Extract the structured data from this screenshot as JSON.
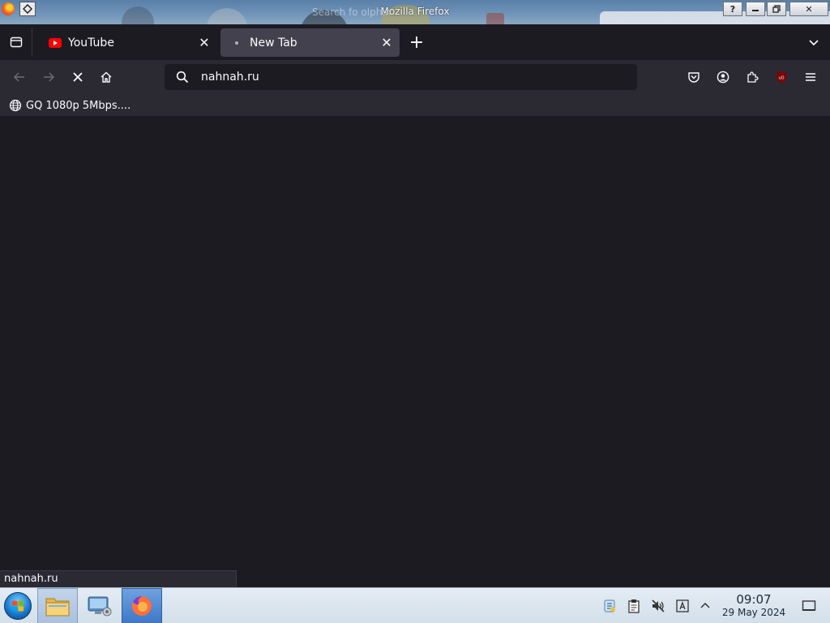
{
  "window": {
    "title": "Mozilla Firefox",
    "background_ghost_text": "Search fo          olphin",
    "help_glyph": "?",
    "close_glyph": "✕"
  },
  "tabs": [
    {
      "label": "YouTube",
      "favicon": "youtube-icon",
      "active": false,
      "close_glyph": "✕"
    },
    {
      "label": "New Tab",
      "favicon": "loading-dot-icon",
      "active": true,
      "close_glyph": "✕"
    }
  ],
  "new_tab_glyph": "+",
  "navbar": {
    "url": "nahnah.ru",
    "icons": [
      "back-icon",
      "forward-icon",
      "stop-icon",
      "home-icon",
      "search-icon",
      "pocket-icon",
      "account-icon",
      "extensions-icon",
      "ublock-icon",
      "menu-icon"
    ]
  },
  "bookmarks": [
    {
      "label": "GQ 1080p 5Mbps....",
      "favicon": "globe-icon"
    }
  ],
  "status_text": "nahnah.ru",
  "taskbar": {
    "items": [
      "file-manager-icon",
      "system-settings-icon",
      "firefox-icon"
    ],
    "tray": [
      "network-icon",
      "clipboard-icon",
      "volume-muted-icon",
      "keyboard-layout-icon",
      "tray-expand-icon",
      "show-desktop-icon"
    ],
    "clock": {
      "time": "09:07",
      "date": "29 May 2024"
    }
  },
  "colors": {
    "toolbar": "#2b2a33",
    "content": "#1c1b22",
    "active_tab": "#42414d",
    "youtube_red": "#ff0000",
    "ublock_red": "#800000"
  }
}
